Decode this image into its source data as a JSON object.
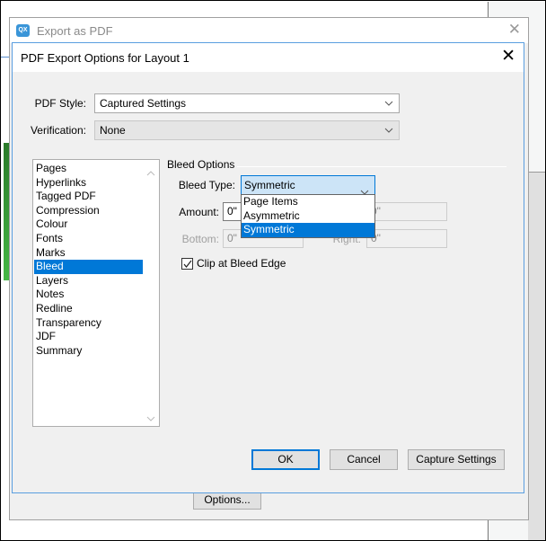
{
  "outer_window": {
    "title": "Export as PDF",
    "icon_text": "QX",
    "options_button": "Options..."
  },
  "dialog": {
    "title": "PDF Export Options for Layout 1",
    "pdf_style": {
      "label": "PDF Style:",
      "value": "Captured Settings"
    },
    "verification": {
      "label": "Verification:",
      "value": "None"
    },
    "categories": [
      {
        "label": "Pages",
        "selected": false
      },
      {
        "label": "Hyperlinks",
        "selected": false
      },
      {
        "label": "Tagged PDF",
        "selected": false
      },
      {
        "label": "Compression",
        "selected": false
      },
      {
        "label": "Colour",
        "selected": false
      },
      {
        "label": "Fonts",
        "selected": false
      },
      {
        "label": "Marks",
        "selected": false
      },
      {
        "label": "Bleed",
        "selected": true
      },
      {
        "label": "Layers",
        "selected": false
      },
      {
        "label": "Notes",
        "selected": false
      },
      {
        "label": "Redline",
        "selected": false
      },
      {
        "label": "Transparency",
        "selected": false
      },
      {
        "label": "JDF",
        "selected": false
      },
      {
        "label": "Summary",
        "selected": false
      }
    ],
    "bleed": {
      "group_title": "Bleed Options",
      "bleed_type_label": "Bleed Type:",
      "bleed_type_value": "Symmetric",
      "bleed_type_options": [
        {
          "label": "Page Items",
          "selected": false
        },
        {
          "label": "Asymmetric",
          "selected": false
        },
        {
          "label": "Symmetric",
          "selected": true
        }
      ],
      "amount_label": "Amount:",
      "amount_value": "0\"",
      "top_value": "0\"",
      "bottom_label": "Bottom:",
      "bottom_value": "0\"",
      "right_label": "Right:",
      "right_value": "0\"",
      "clip_label": "Clip at Bleed Edge",
      "clip_checked": true
    },
    "buttons": {
      "ok": "OK",
      "cancel": "Cancel",
      "capture": "Capture Settings"
    }
  }
}
